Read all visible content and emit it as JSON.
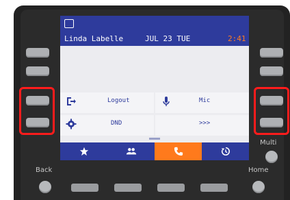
{
  "status_bar": {
    "user_name": "Linda Labelle",
    "date": "JUL 23 TUE",
    "time": "2:41"
  },
  "softkeys": {
    "logout_label": "Logout",
    "mic_label": "Mic",
    "dnd_label": "DND",
    "more_label": ">>>"
  },
  "tabs": [
    {
      "icon": "star-icon"
    },
    {
      "icon": "contacts-icon"
    },
    {
      "icon": "phone-icon",
      "active": true
    },
    {
      "icon": "history-icon"
    }
  ],
  "hardware_labels": {
    "back": "Back",
    "home": "Home",
    "multi": "Multi"
  },
  "colors": {
    "screen_blue": "#2e3b9c",
    "active_orange": "#ff7a1c",
    "time_orange": "#ff7b22",
    "highlight_red": "#ff1c1c"
  }
}
